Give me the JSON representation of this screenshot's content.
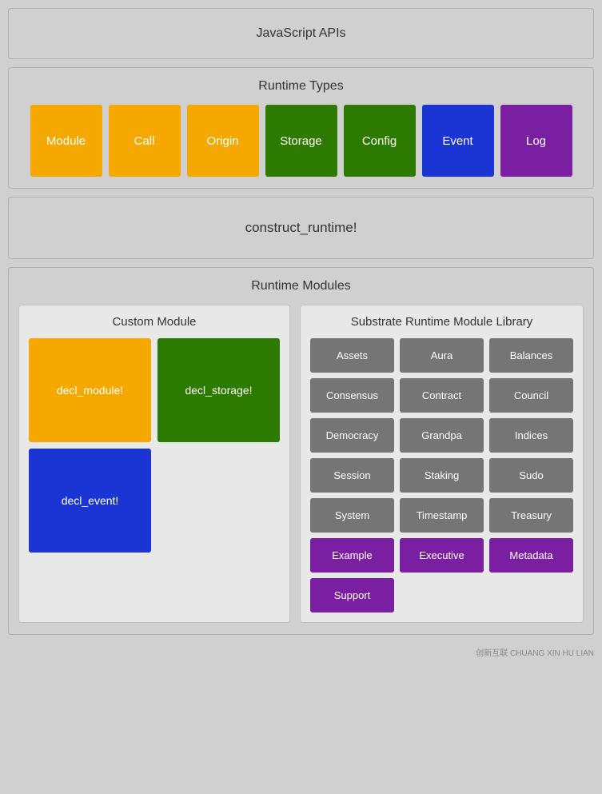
{
  "sections": {
    "jsApis": {
      "title": "JavaScript APIs"
    },
    "runtimeTypes": {
      "title": "Runtime Types",
      "items": [
        {
          "label": "Module",
          "color": "orange"
        },
        {
          "label": "Call",
          "color": "orange"
        },
        {
          "label": "Origin",
          "color": "orange"
        },
        {
          "label": "Storage",
          "color": "green"
        },
        {
          "label": "Config",
          "color": "green"
        },
        {
          "label": "Event",
          "color": "blue"
        },
        {
          "label": "Log",
          "color": "purple"
        }
      ]
    },
    "constructRuntime": {
      "title": "construct_runtime!"
    },
    "runtimeModules": {
      "title": "Runtime Modules",
      "customModule": {
        "title": "Custom Module",
        "items": [
          {
            "label": "decl_module!",
            "color": "orange",
            "span": "single"
          },
          {
            "label": "decl_storage!",
            "color": "green",
            "span": "single"
          },
          {
            "label": "decl_event!",
            "color": "blue",
            "span": "single"
          }
        ]
      },
      "substrateLibrary": {
        "title": "Substrate Runtime Module Library",
        "rows": [
          [
            "Assets",
            "Aura",
            "Balances"
          ],
          [
            "Consensus",
            "Contract",
            "Council"
          ],
          [
            "Democracy",
            "Grandpa",
            "Indices"
          ],
          [
            "Session",
            "Staking",
            "Sudo"
          ],
          [
            "System",
            "Timestamp",
            "Treasury"
          ],
          [
            "Example",
            "Executive",
            "Metadata"
          ],
          [
            "Support",
            "",
            ""
          ]
        ],
        "purpleItems": [
          "Example",
          "Executive",
          "Metadata",
          "Support"
        ]
      }
    }
  }
}
